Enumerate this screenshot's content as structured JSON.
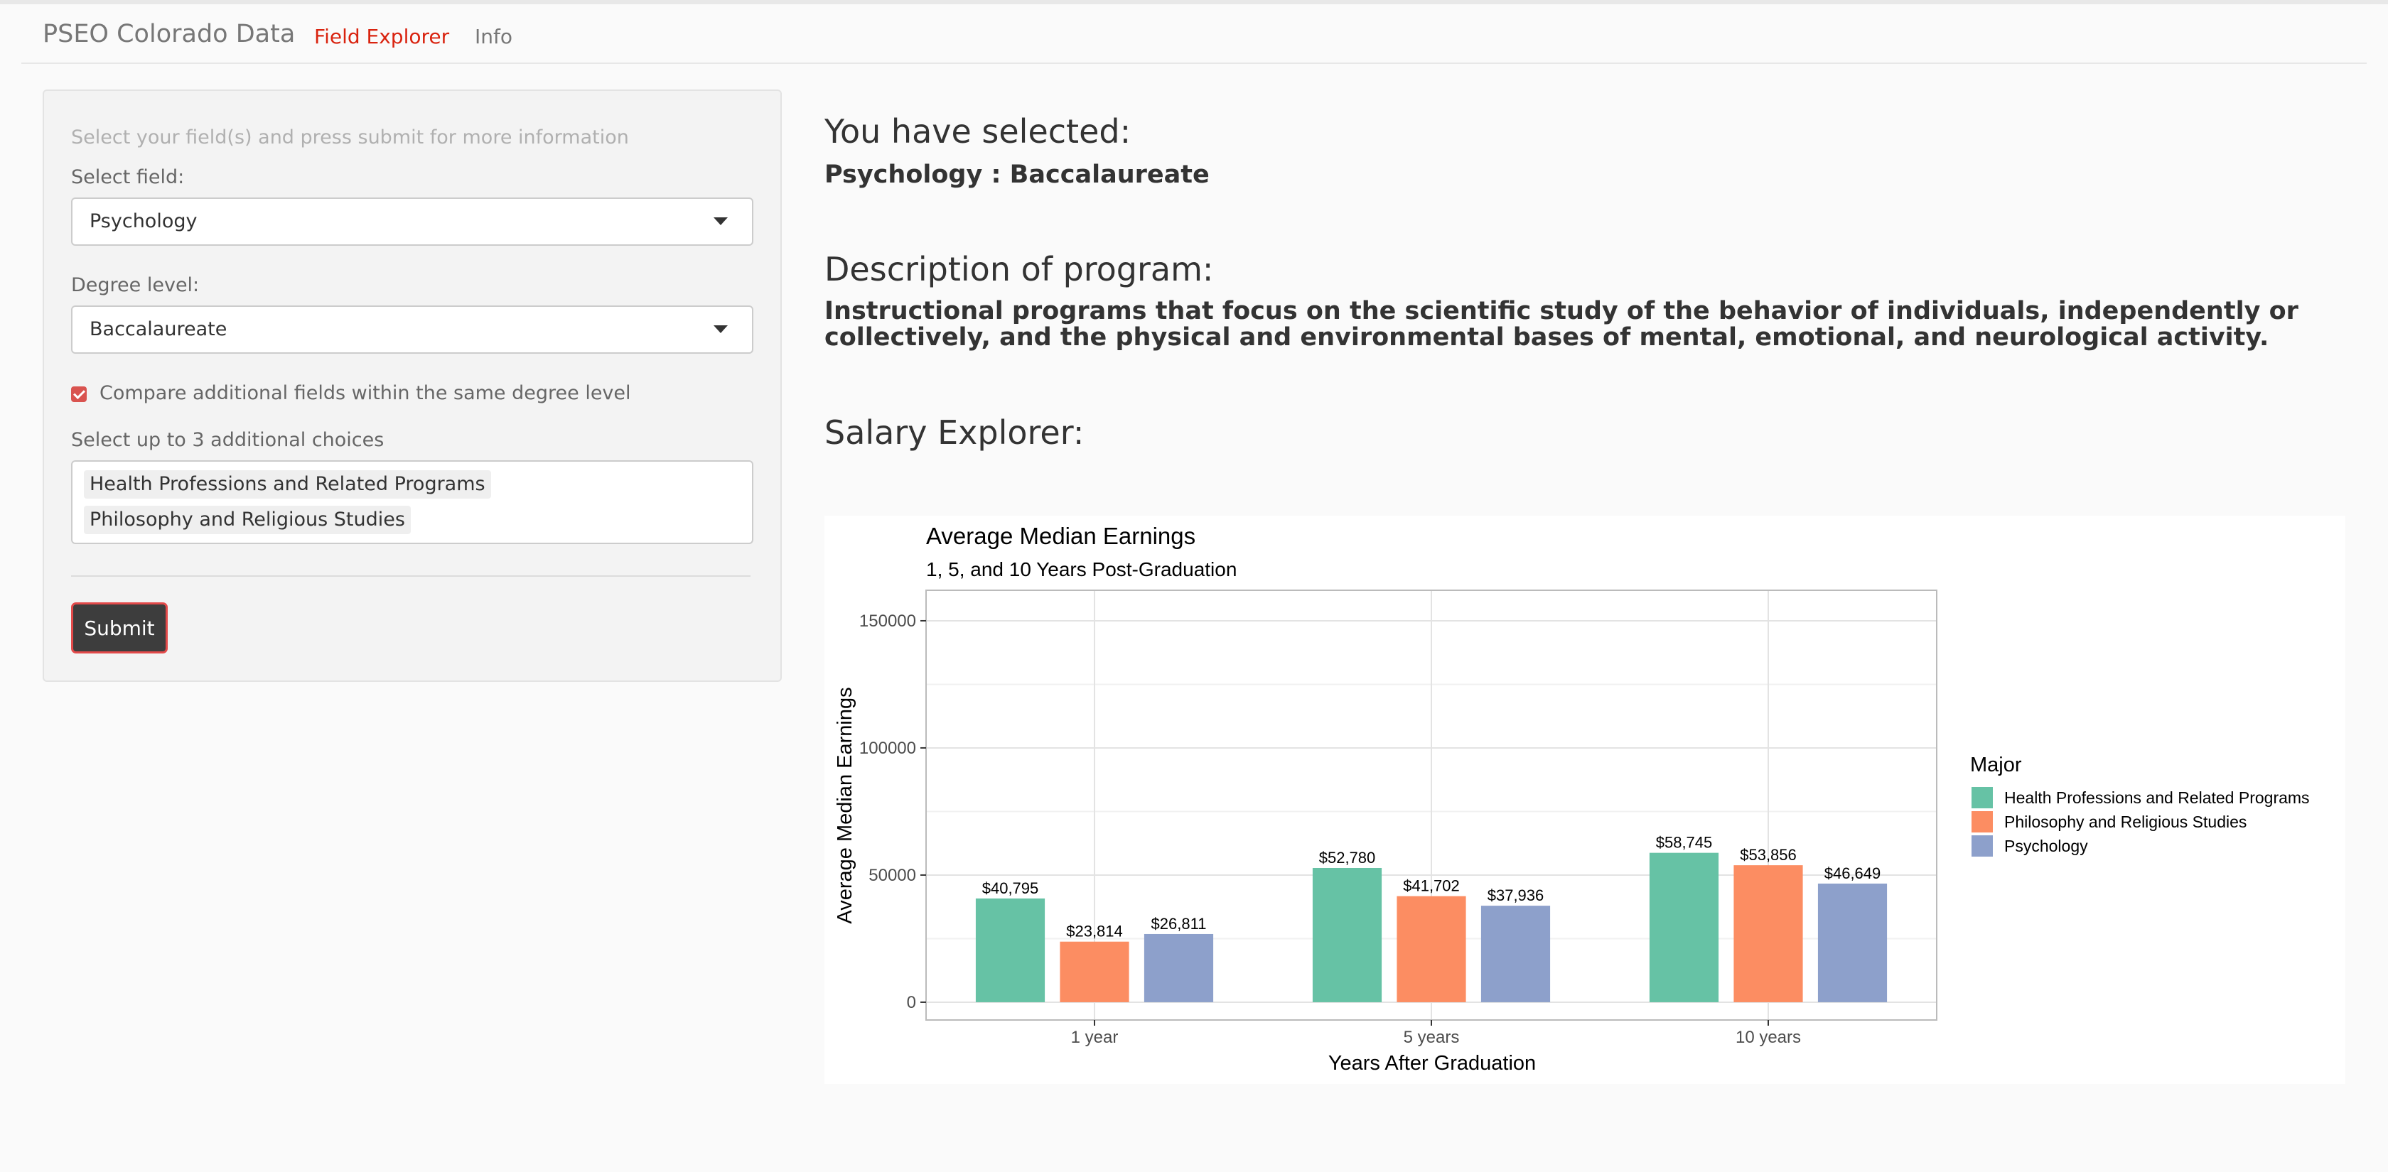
{
  "navbar": {
    "brand": "PSEO Colorado Data",
    "tabs": [
      {
        "label": "Field Explorer",
        "active": true
      },
      {
        "label": "Info",
        "active": false
      }
    ]
  },
  "sidebar": {
    "hint": "Select your field(s) and press submit for more information",
    "field_label": "Select field:",
    "field_value": "Psychology",
    "degree_label": "Degree level:",
    "degree_value": "Baccalaureate",
    "compare_label": "Compare additional fields within the same degree level",
    "compare_checked": true,
    "additional_label": "Select up to 3 additional choices",
    "additional_choices": [
      "Health Professions and Related Programs",
      "Philosophy and Religious Studies"
    ],
    "submit_label": "Submit"
  },
  "main": {
    "selected_heading": "You have selected:",
    "selected_value": "Psychology : Baccalaureate",
    "description_heading": "Description of program:",
    "description_text": "Instructional programs that focus on the scientific study of the behavior of individuals, independently or collectively, and the physical and environmental bases of mental, emotional, and neurological activity.",
    "salary_heading": "Salary Explorer:"
  },
  "colors": {
    "accent": "#d9230f",
    "series": [
      "#66c2a5",
      "#fc8d62",
      "#8da0cb"
    ]
  },
  "chart_data": {
    "type": "bar",
    "title": "Average Median Earnings",
    "subtitle": "1, 5, and 10 Years Post-Graduation",
    "xlabel": "Years After Graduation",
    "ylabel": "Average Median Earnings",
    "categories": [
      "1 year",
      "5 years",
      "10 years"
    ],
    "yticks": [
      0,
      50000,
      100000,
      150000
    ],
    "ylim": [
      -7000,
      162000
    ],
    "grid": true,
    "legend_title": "Major",
    "legend_position": "right",
    "series": [
      {
        "name": "Health Professions and Related Programs",
        "color": "#66c2a5",
        "values": [
          40795,
          52780,
          58745
        ],
        "labels": [
          "$40,795",
          "$52,780",
          "$58,745"
        ]
      },
      {
        "name": "Philosophy and Religious Studies",
        "color": "#fc8d62",
        "values": [
          23814,
          41702,
          53856
        ],
        "labels": [
          "$23,814",
          "$41,702",
          "$53,856"
        ]
      },
      {
        "name": "Psychology",
        "color": "#8da0cb",
        "values": [
          26811,
          37936,
          46649
        ],
        "labels": [
          "$26,811",
          "$37,936",
          "$46,649"
        ]
      }
    ]
  }
}
